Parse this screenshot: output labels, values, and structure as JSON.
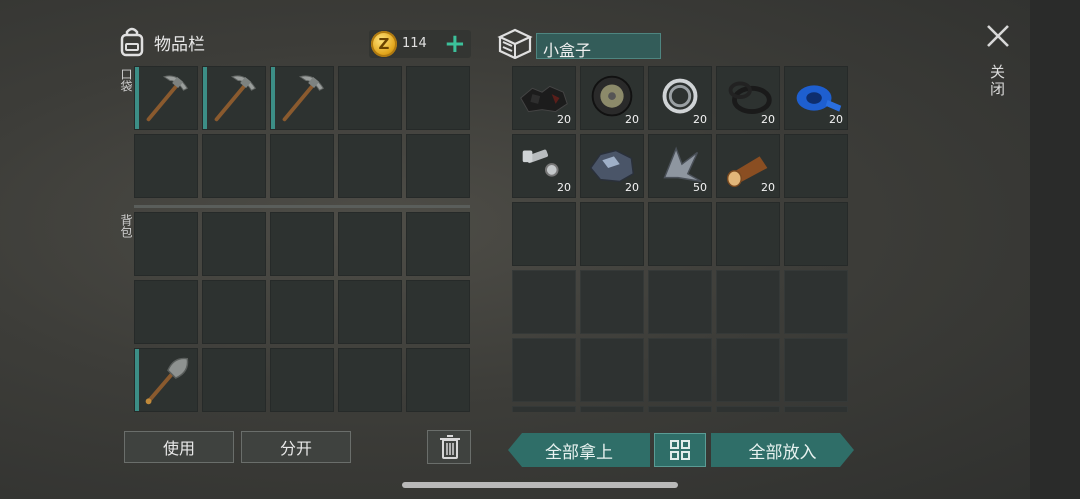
{
  "inventory": {
    "title": "物品栏",
    "coins": "114",
    "coin_symbol": "Z",
    "add_label": "+",
    "pocket_label": "口袋",
    "backpack_label": "背包",
    "pocket_slots": [
      "pickaxe",
      "pickaxe",
      "pickaxe",
      "",
      "",
      "",
      "",
      "",
      "",
      ""
    ],
    "backpack_slots": [
      "",
      "",
      "",
      "",
      "",
      "",
      "",
      "",
      "",
      "",
      "shovel",
      "",
      "",
      "",
      ""
    ]
  },
  "container": {
    "name": "小盒子",
    "items": [
      {
        "icon": "coal-icon",
        "qty": "20"
      },
      {
        "icon": "tire-icon",
        "qty": "20"
      },
      {
        "icon": "bearing-icon",
        "qty": "20"
      },
      {
        "icon": "rubber-ring-icon",
        "qty": "20"
      },
      {
        "icon": "tape-icon",
        "qty": "20"
      },
      {
        "icon": "bolt-nut-icon",
        "qty": "20"
      },
      {
        "icon": "iron-ore-icon",
        "qty": "20"
      },
      {
        "icon": "metal-scrap-icon",
        "qty": "50"
      },
      {
        "icon": "log-icon",
        "qty": "20"
      }
    ]
  },
  "buttons": {
    "use": "使用",
    "split": "分开",
    "take_all": "全部拿上",
    "put_all": "全部放入"
  },
  "close_label": "关闭",
  "colors": {
    "accent": "#2f6e68",
    "slot_marker": "#3c8e86",
    "coin": "#e2a61c",
    "plus": "#3cc09a"
  }
}
